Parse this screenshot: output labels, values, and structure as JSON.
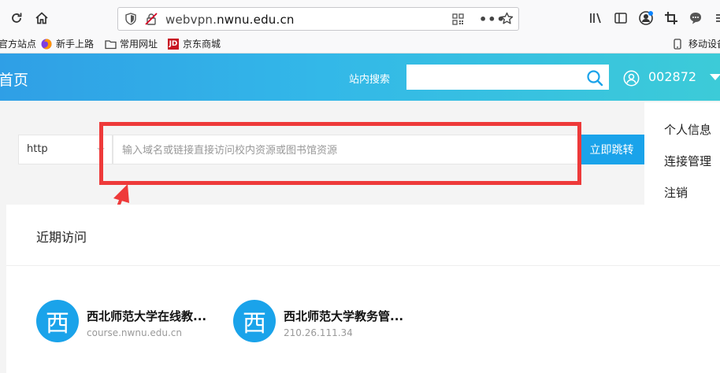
{
  "browser": {
    "url_prefix": "webvpn.",
    "url_domain": "nwnu.edu.cn",
    "bookmarks": [
      {
        "label": "官方站点",
        "icon": "firefox-icon"
      },
      {
        "label": "新手上路",
        "icon": "firefox-icon"
      },
      {
        "label": "常用网址",
        "icon": "folder-icon"
      },
      {
        "label": "京东商城",
        "icon": "jd-icon"
      }
    ],
    "mobile_bookmarks": "移动设备"
  },
  "header": {
    "title": "首页",
    "search_label": "站内搜索",
    "search_placeholder": "",
    "user_id": "002872"
  },
  "user_menu": {
    "items": [
      "个人信息",
      "连接管理",
      "注销"
    ]
  },
  "jump": {
    "scheme": "http",
    "placeholder": "输入域名或链接直接访问校内资源或图书馆资源",
    "button_label": "立即跳转"
  },
  "recent": {
    "title": "近期访问",
    "cards": [
      {
        "avatar": "西",
        "title": "西北师范大学在线教...",
        "url": "course.nwnu.edu.cn"
      },
      {
        "avatar": "西",
        "title": "西北师范大学教务管...",
        "url": "210.26.111.34"
      }
    ]
  },
  "colors": {
    "accent": "#1aa3ea",
    "header_start": "#2f9fe6",
    "header_end": "#3ccbd8",
    "annotation": "#ee3a3a"
  }
}
